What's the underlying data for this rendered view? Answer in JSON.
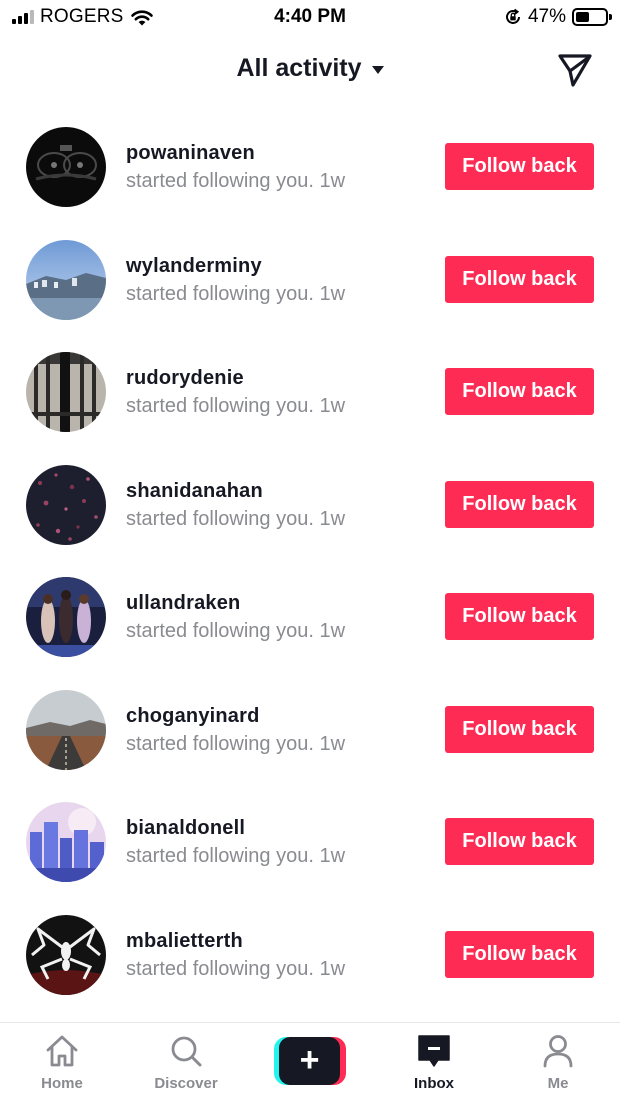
{
  "status_bar": {
    "carrier": "ROGERS",
    "time": "4:40 PM",
    "battery": "47%",
    "battery_level": 0.47
  },
  "header": {
    "title": "All activity",
    "dropdown_icon": "caret-down-icon",
    "action_icon": "send-direct-message-icon"
  },
  "activity": [
    {
      "username": "powaninaven",
      "text": "started following you.",
      "time": "1w",
      "button": "Follow back",
      "avatar": "car-interior"
    },
    {
      "username": "wylanderminy",
      "text": "started following you.",
      "time": "1w",
      "button": "Follow back",
      "avatar": "coastal-town"
    },
    {
      "username": "rudorydenie",
      "text": "started following you.",
      "time": "1w",
      "button": "Follow back",
      "avatar": "iron-gate"
    },
    {
      "username": "shanidanahan",
      "text": "started following you.",
      "time": "1w",
      "button": "Follow back",
      "avatar": "pink-flowers-dark"
    },
    {
      "username": "ullandraken",
      "text": "started following you.",
      "time": "1w",
      "button": "Follow back",
      "avatar": "concert-performers"
    },
    {
      "username": "choganyinard",
      "text": "started following you.",
      "time": "1w",
      "button": "Follow back",
      "avatar": "desert-road"
    },
    {
      "username": "bianaldonell",
      "text": "started following you.",
      "time": "1w",
      "button": "Follow back",
      "avatar": "purple-city"
    },
    {
      "username": "mbalietterth",
      "text": "started following you.",
      "time": "1w",
      "button": "Follow back",
      "avatar": "spider-logo"
    }
  ],
  "tabbar": {
    "home": "Home",
    "discover": "Discover",
    "inbox": "Inbox",
    "me": "Me",
    "active": "Inbox"
  },
  "colors": {
    "accent": "#fe2c55",
    "accent_cyan": "#25f4ee",
    "text_primary": "#161823",
    "text_secondary": "#8a8b91"
  }
}
